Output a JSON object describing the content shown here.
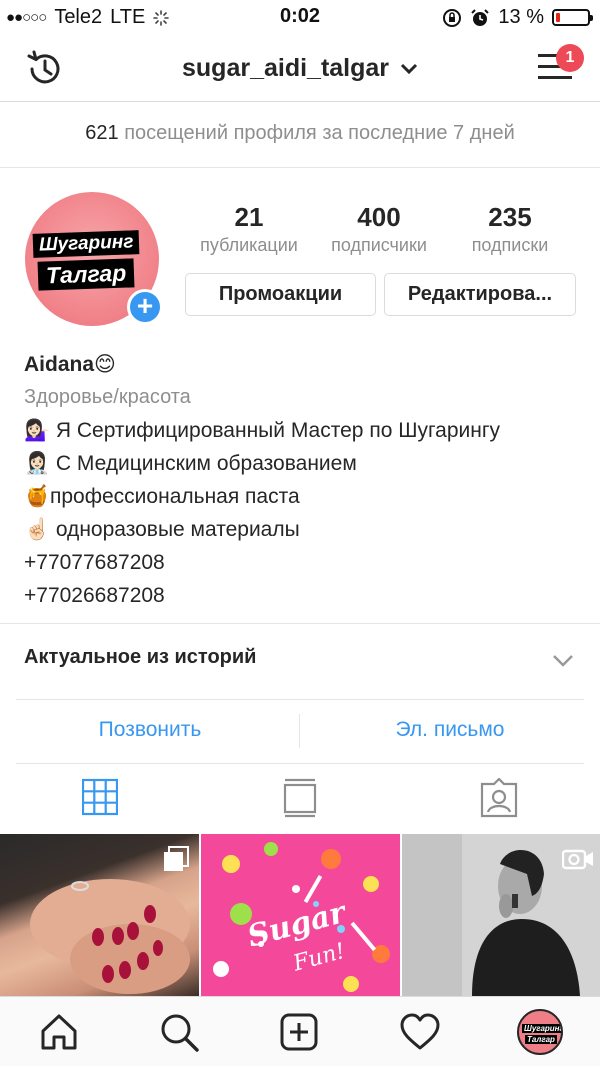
{
  "status_bar": {
    "carrier": "Tele2",
    "network": "LTE",
    "time": "0:02",
    "battery": "13 %",
    "battery_level": 0.13
  },
  "nav": {
    "username": "sugar_aidi_talgar",
    "notification_count": "1"
  },
  "visits": {
    "count": "621",
    "text": "посещений профиля за последние 7 дней"
  },
  "profile": {
    "avatar_text_1": "Шугаринг",
    "avatar_text_2": "Талгар",
    "stats": [
      {
        "value": "21",
        "label": "публикации"
      },
      {
        "value": "400",
        "label": "подписчики"
      },
      {
        "value": "235",
        "label": "подписки"
      }
    ],
    "promo_button": "Промоакции",
    "edit_button": "Редактирова..."
  },
  "bio": {
    "name": "Aidana😊",
    "category": "Здоровье/красота",
    "lines": [
      {
        "emoji": "💁🏻‍♀️",
        "text": "Я Сертифицированный Мастер по Шугарингу"
      },
      {
        "emoji": "👩🏻‍⚕️",
        "text": "С Медицинским образованием"
      },
      {
        "emoji": "🍯",
        "text": "профессиональная паста"
      },
      {
        "emoji": "☝🏻",
        "text": "одноразовые материалы"
      }
    ],
    "phone1": "+77077687208",
    "phone2": "+77026687208"
  },
  "highlights": {
    "title": "Актуальное из историй"
  },
  "contact": {
    "call": "Позвонить",
    "email": "Эл. письмо"
  },
  "colors": {
    "accent": "#3897f0",
    "badge": "#ed4956",
    "avatar_bg": "#f07e86"
  }
}
